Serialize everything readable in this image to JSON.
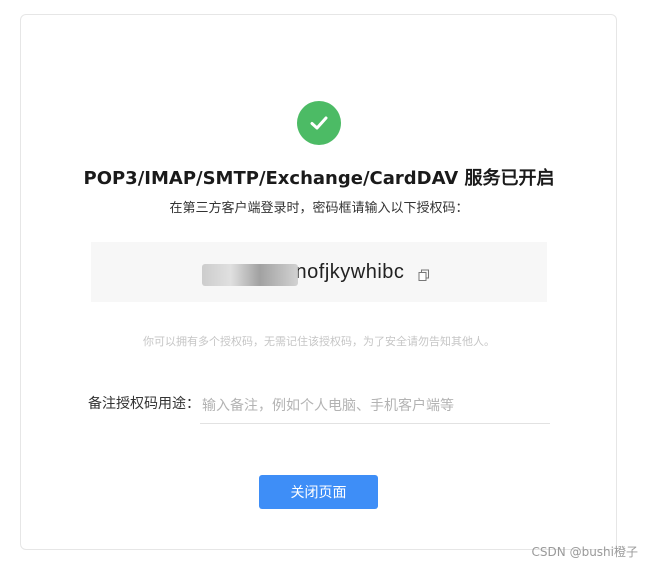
{
  "header": {
    "title": "POP3/IMAP/SMTP/Exchange/CardDAV 服务已开启",
    "subtitle": "在第三方客户端登录时，密码框请输入以下授权码："
  },
  "auth_code": {
    "visible_text": "nofjkywhibc",
    "icons": {
      "copy": "copy-icon",
      "status": "check-icon"
    }
  },
  "hint": "你可以拥有多个授权码，无需记住该授权码，为了安全请勿告知其他人。",
  "note": {
    "label": "备注授权码用途：",
    "placeholder": "输入备注，例如个人电脑、手机客户端等"
  },
  "actions": {
    "close_label": "关闭页面"
  },
  "watermark": "CSDN @bushi橙子",
  "colors": {
    "success": "#4cbb65",
    "primary": "#3e8ef7"
  }
}
